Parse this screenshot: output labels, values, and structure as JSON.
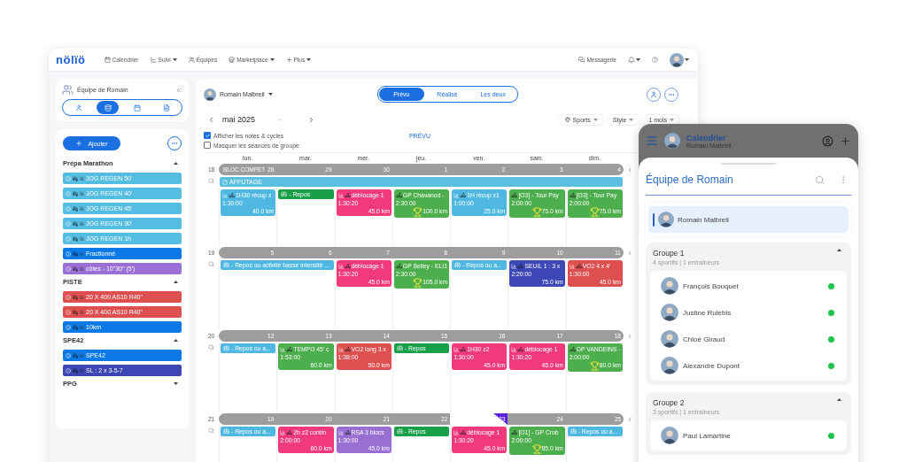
{
  "nav": {
    "logo": "nölïö",
    "items": [
      {
        "label": "Calendrier",
        "dropdown": false
      },
      {
        "label": "Suivi",
        "dropdown": true
      },
      {
        "label": "Équipes",
        "dropdown": false
      },
      {
        "label": "Marketplace",
        "dropdown": true
      },
      {
        "label": "Plus",
        "dropdown": true
      }
    ],
    "messages": "Messagerie"
  },
  "sidebar": {
    "team": "Équipe de Romain",
    "view_tabs": [
      {
        "selected": false
      },
      {
        "selected": true
      },
      {
        "selected": false
      },
      {
        "selected": false
      }
    ],
    "add_button": "Ajouter",
    "sections": [
      {
        "title": "Prépa Marathon",
        "expanded": true,
        "items": [
          {
            "label": "JOG REGEN 50'",
            "color": "#55bde2"
          },
          {
            "label": "JOG REGEN 40'",
            "color": "#55bde2"
          },
          {
            "label": "JOG REGEN 45'",
            "color": "#55bde2"
          },
          {
            "label": "JOG REGEN 30'",
            "color": "#55bde2"
          },
          {
            "label": "JOG REGEN 1h",
            "color": "#55bde2"
          },
          {
            "label": "Fractionné",
            "color": "#0b7ae6"
          },
          {
            "label": "côtes - 10\"30\" (5')",
            "color": "#9b70d6"
          }
        ]
      },
      {
        "title": "PISTE",
        "expanded": true,
        "items": [
          {
            "label": "20 X 400 AS10 R40\"",
            "color": "#de5050"
          },
          {
            "label": "20 X 400 AS10 R40\"",
            "color": "#de5050"
          },
          {
            "label": "10km",
            "color": "#0b7ae6"
          }
        ]
      },
      {
        "title": "SPE42",
        "expanded": true,
        "items": [
          {
            "label": "SPE42",
            "color": "#0b7ae6"
          },
          {
            "label": "SL : 2 x 3-5-7",
            "color": "#3c46b4"
          }
        ]
      },
      {
        "title": "PPG",
        "expanded": false
      }
    ]
  },
  "calendar": {
    "athlete": "Romain Malbreil",
    "mode_tabs": [
      {
        "label": "Prévu",
        "selected": true
      },
      {
        "label": "Réalisé",
        "selected": false
      },
      {
        "label": "Les deux",
        "selected": false
      }
    ],
    "month": "mai 2025",
    "filters": [
      "Sports",
      "Style",
      "1 mois"
    ],
    "options": [
      {
        "label": "Afficher les notes & cycles",
        "checked": true
      },
      {
        "label": "Masquer les séances de groupe",
        "checked": false
      }
    ],
    "view_title": "PRÉVU",
    "weekdays": [
      "lun.",
      "mar.",
      "mer.",
      "jeu.",
      "ven.",
      "sam.",
      "dim."
    ],
    "weeks": [
      {
        "number": "18",
        "cycle": "BLOC COMPET",
        "note": "AFFUTAGE",
        "days": [
          {
            "date": "28",
            "today": false,
            "events": [
              {
                "kind": "session",
                "title": "1H30 récup z",
                "duration": "1:30:00",
                "distance": "40.0 km",
                "color": "#4fb8e2",
                "trophy": false
              }
            ]
          },
          {
            "date": "29",
            "today": false,
            "events": [
              {
                "kind": "rest",
                "title": "- Repos",
                "color": "#17a047"
              }
            ]
          },
          {
            "date": "30",
            "today": false,
            "events": [
              {
                "kind": "session",
                "title": "déblocage 1",
                "duration": "1:30:20",
                "distance": "45.0 km",
                "color": "#f03a7c",
                "trophy": false
              }
            ]
          },
          {
            "date": "1",
            "today": false,
            "events": [
              {
                "kind": "session",
                "title": "GP Chavanod -",
                "duration": "2:30:00",
                "distance": "100.0 km",
                "color": "#4cae4c",
                "trophy": true
              }
            ]
          },
          {
            "date": "2",
            "today": false,
            "events": [
              {
                "kind": "session",
                "title": "1H récup z1",
                "duration": "1:00:00",
                "distance": "25.0 km",
                "color": "#4fb8e2",
                "trophy": false
              }
            ]
          },
          {
            "date": "3",
            "today": false,
            "events": [
              {
                "kind": "session",
                "title": "[O3] - Tour Pay",
                "duration": "2:00:00",
                "distance": "75.0 km",
                "color": "#4cae4c",
                "trophy": true
              }
            ]
          },
          {
            "date": "4",
            "today": false,
            "events": [
              {
                "kind": "session",
                "title": "[O3] - Tour Pay",
                "duration": "2:00:00",
                "distance": "75.0 km",
                "color": "#4cae4c",
                "trophy": true
              }
            ]
          }
        ]
      },
      {
        "number": "19",
        "days": [
          {
            "date": "5",
            "today": false,
            "events": [
              {
                "kind": "rest",
                "title": "- Repos ou activité basse intensité ...",
                "color": "#4fb8e2",
                "spans_next_day": true
              }
            ]
          },
          {
            "date": "6",
            "today": false
          },
          {
            "date": "7",
            "today": false,
            "events": [
              {
                "kind": "session",
                "title": "déblocage 1",
                "duration": "1:30:20",
                "distance": "45.0 km",
                "color": "#f03a7c",
                "trophy": false
              }
            ]
          },
          {
            "date": "8",
            "today": false,
            "events": [
              {
                "kind": "session",
                "title": "GP Belley - ELI1",
                "duration": "2:30:00",
                "distance": "105.0 km",
                "color": "#4cae4c",
                "trophy": true
              }
            ]
          },
          {
            "date": "9",
            "today": false,
            "events": [
              {
                "kind": "rest",
                "title": "- Repos ou a...",
                "color": "#4fb8e2"
              }
            ]
          },
          {
            "date": "10",
            "today": false,
            "events": [
              {
                "kind": "session",
                "title": "SEUIL 1 : 3 x",
                "duration": "2:20:00",
                "distance": "75.0 km",
                "color": "#3d47b5",
                "trophy": false
              }
            ]
          },
          {
            "date": "11",
            "today": false,
            "events": [
              {
                "kind": "session",
                "title": "VO2 4 x 4'",
                "duration": "1:30:00",
                "distance": "45.0 km",
                "color": "#de4f4f",
                "trophy": false
              }
            ]
          }
        ]
      },
      {
        "number": "20",
        "days": [
          {
            "date": "12",
            "today": false,
            "events": [
              {
                "kind": "rest",
                "title": "- Repos ou a...",
                "color": "#4fb8e2"
              }
            ]
          },
          {
            "date": "13",
            "today": false,
            "events": [
              {
                "kind": "session",
                "title": "TEMPO 45' c",
                "duration": "1:53:00",
                "distance": "60.0 km",
                "color": "#4cae4c",
                "trophy": false
              }
            ]
          },
          {
            "date": "14",
            "today": false,
            "events": [
              {
                "kind": "session",
                "title": "VO2 long 3 x",
                "duration": "1:38:00",
                "distance": "50.0 km",
                "color": "#de4f4f",
                "trophy": false
              }
            ]
          },
          {
            "date": "15",
            "today": false,
            "events": [
              {
                "kind": "rest",
                "title": "- Repos",
                "color": "#17a047"
              }
            ]
          },
          {
            "date": "16",
            "today": false,
            "events": [
              {
                "kind": "session",
                "title": "1H30 z2",
                "duration": "1:30:00",
                "distance": "45.0 km",
                "color": "#f03a7c",
                "trophy": false
              }
            ]
          },
          {
            "date": "17",
            "today": false,
            "events": [
              {
                "kind": "session",
                "title": "déblocage 1",
                "duration": "1:30:20",
                "distance": "45.0 km",
                "color": "#f03a7c",
                "trophy": false
              }
            ]
          },
          {
            "date": "18",
            "today": false,
            "events": [
              {
                "kind": "session",
                "title": "GP VANDEINS -",
                "duration": "2:00:00",
                "distance": "80.0 km",
                "color": "#4cae4c",
                "trophy": true
              }
            ]
          }
        ]
      },
      {
        "number": "21",
        "days": [
          {
            "date": "19",
            "today": false,
            "events": [
              {
                "kind": "rest",
                "title": "- Repos ou a...",
                "color": "#4fb8e2"
              }
            ]
          },
          {
            "date": "20",
            "today": false,
            "events": [
              {
                "kind": "session",
                "title": "2h z2 contin",
                "duration": "2:00:00",
                "distance": "60.0 km",
                "color": "#f03a7c",
                "trophy": false
              }
            ]
          },
          {
            "date": "21",
            "today": false,
            "events": [
              {
                "kind": "session",
                "title": "RSA 3 blocs",
                "duration": "1:30:00",
                "distance": "45.0 km",
                "color": "#9a6fd4",
                "trophy": false
              }
            ]
          },
          {
            "date": "22",
            "today": false,
            "events": [
              {
                "kind": "rest",
                "title": "- Repos",
                "color": "#17a047"
              }
            ]
          },
          {
            "date": "23",
            "today": true,
            "events": [
              {
                "kind": "session",
                "title": "déblocage 1",
                "duration": "1:30:20",
                "distance": "45.0 km",
                "color": "#f03a7c",
                "trophy": false
              }
            ]
          },
          {
            "date": "24",
            "today": false,
            "events": [
              {
                "kind": "session",
                "title": "[O1] - GP Crob",
                "duration": "2:00:00",
                "distance": "85.0 km",
                "color": "#4cae4c",
                "trophy": true
              }
            ]
          },
          {
            "date": "25",
            "today": false,
            "events": [
              {
                "kind": "rest",
                "title": "- Repos ou a...",
                "color": "#4fb8e2"
              }
            ]
          }
        ]
      }
    ]
  },
  "phone": {
    "title": "Calendrier",
    "subtitle": "Romain Malbreil",
    "sheet_title": "Équipe de Romain",
    "coach": "Romain Malbreil",
    "groups": [
      {
        "name": "Groupe 1",
        "info": "4 sportifs | 1 entraîneurs",
        "expanded": true,
        "members": [
          {
            "name": "François Bouquet",
            "online": true
          },
          {
            "name": "Justine Rulebis",
            "online": true
          },
          {
            "name": "Chloé Giraud",
            "online": true
          },
          {
            "name": "Alexandre Dupont",
            "online": true
          }
        ]
      },
      {
        "name": "Groupe 2",
        "info": "3 sportifs | 1 entraîneurs",
        "expanded": true,
        "members": [
          {
            "name": "Paul Lamartine",
            "online": true
          }
        ]
      }
    ]
  }
}
